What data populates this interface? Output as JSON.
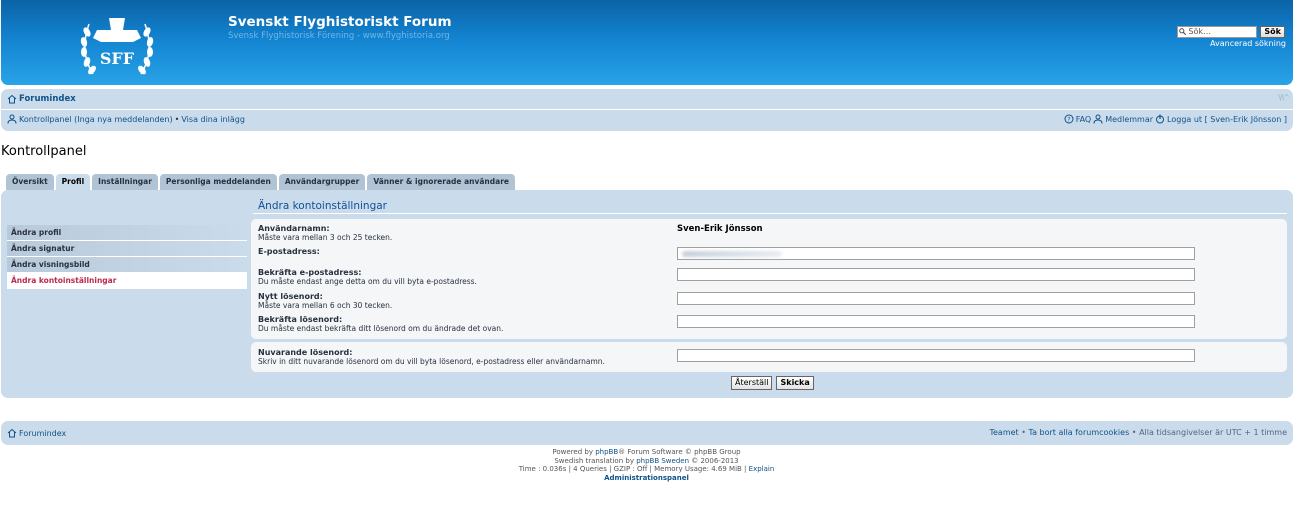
{
  "header": {
    "logo_text": "SFF",
    "site_title": "Svenskt Flyghistoriskt Forum",
    "site_desc": "Svensk Flyghistorisk Förening - www.flyghistoria.org",
    "search_placeholder": "Sök…",
    "search_button": "Sök",
    "advanced_search": "Avancerad sökning"
  },
  "navbar": {
    "forum_index": "Forumindex",
    "collapse": "\\/\\^",
    "control_panel": "Kontrollpanel (Inga nya meddelanden)",
    "separator": "•",
    "show_posts": "Visa dina inlägg",
    "faq": "FAQ",
    "members": "Medlemmar",
    "logout": "Logga ut [ Sven-Erik Jönsson ]"
  },
  "page_title": "Kontrollpanel",
  "tabs": [
    {
      "label": "Översikt",
      "active": false
    },
    {
      "label": "Profil",
      "active": true
    },
    {
      "label": "Inställningar",
      "active": false
    },
    {
      "label": "Personliga meddelanden",
      "active": false
    },
    {
      "label": "Användargrupper",
      "active": false
    },
    {
      "label": "Vänner & ignorerade användare",
      "active": false
    }
  ],
  "menu": [
    {
      "label": "Ändra profil",
      "active": false
    },
    {
      "label": "Ändra signatur",
      "active": false
    },
    {
      "label": "Ändra visningsbild",
      "active": false
    },
    {
      "label": "Ändra kontoinställningar",
      "active": true
    }
  ],
  "content": {
    "title": "Ändra kontoinställningar",
    "username_label": "Användarnamn:",
    "username_desc": "Måste vara mellan 3 och 25 tecken.",
    "username_value": "Sven-Erik Jönsson",
    "email_label": "E-postadress:",
    "email_value": "",
    "confirm_email_label": "Bekräfta e-postadress:",
    "confirm_email_desc": "Du måste endast ange detta om du vill byta e-postadress.",
    "new_password_label": "Nytt lösenord:",
    "new_password_desc": "Måste vara mellan 6 och 30 tecken.",
    "confirm_password_label": "Bekräfta lösenord:",
    "confirm_password_desc": "Du måste endast bekräfta ditt lösenord om du ändrade det ovan.",
    "current_password_label": "Nuvarande lösenord:",
    "current_password_desc": "Skriv in ditt nuvarande lösenord om du vill byta lösenord, e-postadress eller användarnamn.",
    "reset_button": "Återställ",
    "submit_button": "Skicka"
  },
  "footer": {
    "forum_index": "Forumindex",
    "team": "Teamet",
    "delete_cookies": "Ta bort alla forumcookies",
    "timezone": "Alla tidsangivelser är UTC + 1 timme",
    "sep": "•",
    "powered_prefix": "Powered by ",
    "phpbb": "phpBB",
    "powered_suffix": "® Forum Software © phpBB Group",
    "translation_prefix": "Swedish translation by ",
    "phpbb_sweden": "phpBB Sweden",
    "translation_suffix": " © 2006-2013",
    "debug": "Time : 0.036s | 4 Queries | GZIP : Off | Memory Usage: 4.69 MiB | ",
    "explain": "Explain",
    "admin_panel": "Administrationspanel"
  },
  "colors": {
    "header_top": "#0b63a6",
    "header_bottom": "#28a3e8",
    "panel_bg": "#cadceb",
    "active_menu_text": "#bc2a4d",
    "link": "#105289"
  }
}
